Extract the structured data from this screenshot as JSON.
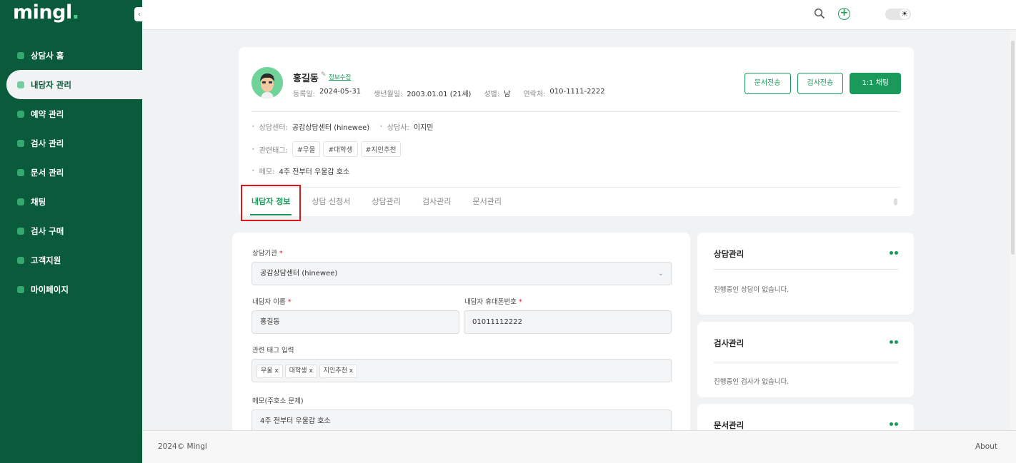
{
  "app": {
    "logo": "mingl",
    "logo_dot": "."
  },
  "sidebar": {
    "items": [
      {
        "label": "상담사 홈",
        "icon": "home-icon"
      },
      {
        "label": "내담자 관리",
        "icon": "user-icon",
        "active": true
      },
      {
        "label": "예약 관리",
        "icon": "calendar-icon"
      },
      {
        "label": "검사 관리",
        "icon": "test-icon"
      },
      {
        "label": "문서 관리",
        "icon": "document-icon"
      },
      {
        "label": "채팅",
        "icon": "chat-icon"
      },
      {
        "label": "검사 구매",
        "icon": "cart-icon"
      },
      {
        "label": "고객지원",
        "icon": "support-icon"
      },
      {
        "label": "마이페이지",
        "icon": "profile-icon"
      }
    ]
  },
  "topbar": {
    "toggle_icon": "☀"
  },
  "profile": {
    "name": "홍길동",
    "edit_label": "정보수정",
    "reg_label": "등록일:",
    "reg_value": "2024-05-31",
    "birth_label": "생년월일:",
    "birth_value": "2003.01.01 (21세)",
    "gender_label": "성별:",
    "gender_value": "남",
    "phone_label": "연락처:",
    "phone_value": "010-1111-2222",
    "buttons": {
      "doc_send": "문서전송",
      "test_send": "검사전송",
      "chat": "1:1 채팅"
    },
    "center_label": "상담센터:",
    "center_value": "공감상담센터 (hinewee)",
    "counselor_label": "상담사:",
    "counselor_value": "이지민",
    "tags_label": "관련태그:",
    "tags": [
      "#우울",
      "#대학생",
      "#지인추천"
    ],
    "memo_label": "메모:",
    "memo_value": "4주 전부터 우울감 호소"
  },
  "tabs": [
    "내담자 정보",
    "상담 신청서",
    "상담관리",
    "검사관리",
    "문서관리"
  ],
  "form": {
    "agency_label": "상담기관",
    "agency_value": "공감상담센터 (hinewee)",
    "name_label": "내담자 이름",
    "name_value": "홍길동",
    "phone_label": "내담자 휴대폰번호",
    "phone_value": "01011112222",
    "tag_label": "관련 태그 입력",
    "tag_chips": [
      "우울 x",
      "대학생 x",
      "지인추천 x"
    ],
    "memo_label": "메모(주호소 문제)",
    "memo_value": "4주 전부터 우울감 호소",
    "required_mark": "*"
  },
  "right_cards": [
    {
      "title": "상담관리",
      "text": "진행중인 상담이 없습니다."
    },
    {
      "title": "검사관리",
      "text": "진행중인 검사가 없습니다."
    },
    {
      "title": "문서관리",
      "text": ""
    }
  ],
  "footer": {
    "copyright": "2024© Mingl",
    "about": "About"
  },
  "colors": {
    "sidebar": "#0a5a3c",
    "accent": "#1a9a5a",
    "highlight": "#e0161b"
  }
}
